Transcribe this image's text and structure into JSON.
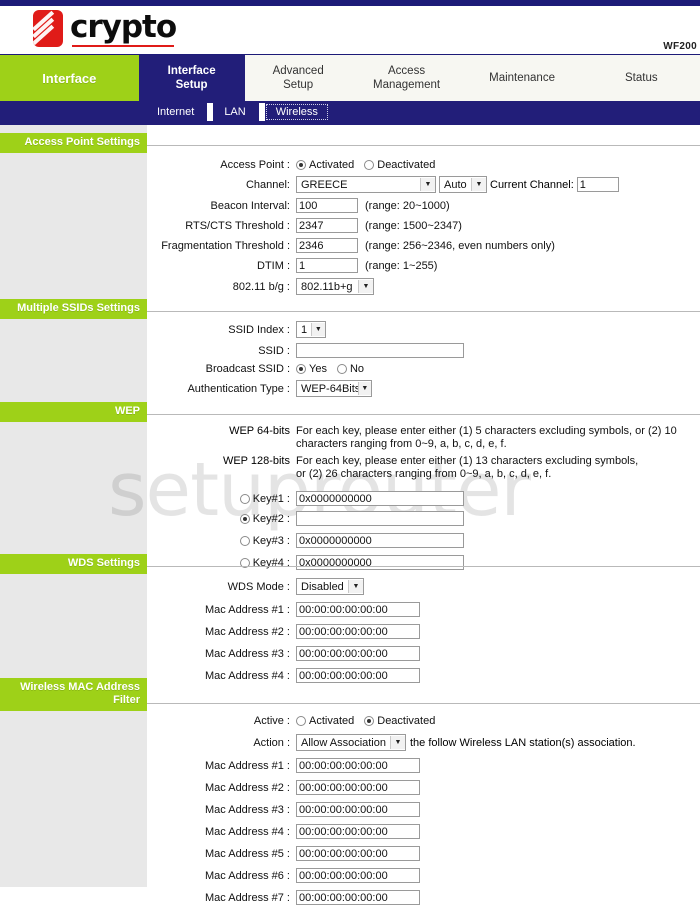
{
  "header": {
    "logo_text": "crypto",
    "model": "WF200"
  },
  "nav": {
    "brand": "Interface",
    "tabs": [
      {
        "label": "Interface\nSetup",
        "selected": true
      },
      {
        "label": "Advanced\nSetup",
        "selected": false
      },
      {
        "label": "Access\nManagement",
        "selected": false
      },
      {
        "label": "Maintenance",
        "selected": false
      },
      {
        "label": "Status",
        "selected": false
      }
    ],
    "subtabs": [
      {
        "label": "Internet",
        "selected": false
      },
      {
        "label": "LAN",
        "selected": false
      },
      {
        "label": "Wireless",
        "selected": true
      }
    ]
  },
  "sections": {
    "access_point": {
      "title": "Access Point Settings",
      "access_point_label": "Access Point :",
      "activated_label": "Activated",
      "deactivated_label": "Deactivated",
      "access_point_value": "Activated",
      "channel_label": "Channel:",
      "channel_value": "GREECE",
      "channel_auto_value": "Auto",
      "current_channel_label": "Current Channel:",
      "current_channel_value": "1",
      "beacon_label": "Beacon Interval:",
      "beacon_value": "100",
      "beacon_hint": "(range: 20~1000)",
      "rts_label": "RTS/CTS Threshold :",
      "rts_value": "2347",
      "rts_hint": "(range: 1500~2347)",
      "frag_label": "Fragmentation Threshold :",
      "frag_value": "2346",
      "frag_hint": "(range: 256~2346, even numbers only)",
      "dtim_label": "DTIM :",
      "dtim_value": "1",
      "dtim_hint": "(range: 1~255)",
      "mode_label": "802.11 b/g :",
      "mode_value": "802.11b+g"
    },
    "multiple_ssid": {
      "title": "Multiple SSIDs Settings",
      "ssid_index_label": "SSID Index :",
      "ssid_index_value": "1",
      "ssid_label": "SSID :",
      "ssid_value": "",
      "broadcast_label": "Broadcast SSID :",
      "yes_label": "Yes",
      "no_label": "No",
      "broadcast_value": "Yes",
      "auth_label": "Authentication Type :",
      "auth_value": "WEP-64Bits"
    },
    "wep": {
      "title": "WEP",
      "wep64_label": "WEP 64-bits",
      "wep64_desc": "For each key, please enter either (1) 5 characters excluding symbols, or (2) 10 characters ranging from 0~9, a, b, c, d, e, f.",
      "wep128_label": "WEP 128-bits",
      "wep128_desc": "For each key, please enter either (1) 13 characters excluding symbols, or (2) 26 characters ranging from 0~9, a, b, c, d, e, f.",
      "keys": [
        {
          "label": "Key#1 :",
          "value": "0x0000000000",
          "selected": false
        },
        {
          "label": "Key#2 :",
          "value": "",
          "selected": true
        },
        {
          "label": "Key#3 :",
          "value": "0x0000000000",
          "selected": false
        },
        {
          "label": "Key#4 :",
          "value": "0x0000000000",
          "selected": false
        }
      ]
    },
    "wds": {
      "title": "WDS Settings",
      "mode_label": "WDS Mode :",
      "mode_value": "Disabled",
      "macs": [
        {
          "label": "Mac Address #1 :",
          "value": "00:00:00:00:00:00"
        },
        {
          "label": "Mac Address #2 :",
          "value": "00:00:00:00:00:00"
        },
        {
          "label": "Mac Address #3 :",
          "value": "00:00:00:00:00:00"
        },
        {
          "label": "Mac Address #4 :",
          "value": "00:00:00:00:00:00"
        }
      ]
    },
    "mac_filter": {
      "title": "Wireless MAC Address Filter",
      "active_label": "Active :",
      "activated_label": "Activated",
      "deactivated_label": "Deactivated",
      "active_value": "Deactivated",
      "action_label": "Action :",
      "action_value": "Allow Association",
      "action_suffix": "the follow Wireless LAN station(s) association.",
      "macs": [
        {
          "label": "Mac Address #1 :",
          "value": "00:00:00:00:00:00"
        },
        {
          "label": "Mac Address #2 :",
          "value": "00:00:00:00:00:00"
        },
        {
          "label": "Mac Address #3 :",
          "value": "00:00:00:00:00:00"
        },
        {
          "label": "Mac Address #4 :",
          "value": "00:00:00:00:00:00"
        },
        {
          "label": "Mac Address #5 :",
          "value": "00:00:00:00:00:00"
        },
        {
          "label": "Mac Address #6 :",
          "value": "00:00:00:00:00:00"
        },
        {
          "label": "Mac Address #7 :",
          "value": "00:00:00:00:00:00"
        }
      ]
    }
  },
  "watermark": "setuprouter"
}
